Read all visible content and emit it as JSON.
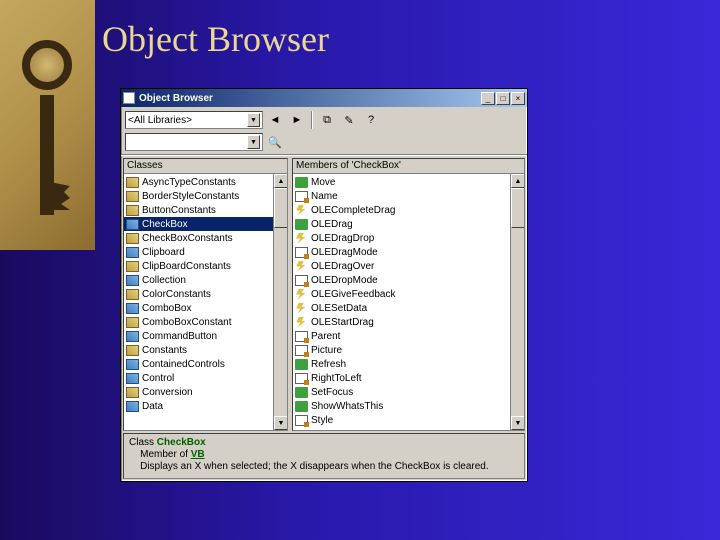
{
  "slide": {
    "title": "Object Browser"
  },
  "window": {
    "title": "Object Browser",
    "library_combo": "<All Libraries>",
    "search_combo": "",
    "nav_back_glyph": "◄",
    "nav_fwd_glyph": "►",
    "copy_glyph": "⧉",
    "def_glyph": "✎",
    "help_glyph": "?",
    "min_glyph": "_",
    "max_glyph": "□",
    "close_glyph": "×",
    "dd_glyph": "▼",
    "up_glyph": "▲",
    "search_glyph": "🔍"
  },
  "classes": {
    "header": "Classes",
    "items": [
      {
        "icon": "enum",
        "label": "AsyncTypeConstants"
      },
      {
        "icon": "enum",
        "label": "BorderStyleConstants"
      },
      {
        "icon": "enum",
        "label": "ButtonConstants"
      },
      {
        "icon": "class",
        "label": "CheckBox",
        "selected": true
      },
      {
        "icon": "enum",
        "label": "CheckBoxConstants"
      },
      {
        "icon": "class",
        "label": "Clipboard"
      },
      {
        "icon": "enum",
        "label": "ClipBoardConstants"
      },
      {
        "icon": "class",
        "label": "Collection"
      },
      {
        "icon": "enum",
        "label": "ColorConstants"
      },
      {
        "icon": "class",
        "label": "ComboBox"
      },
      {
        "icon": "enum",
        "label": "ComboBoxConstant"
      },
      {
        "icon": "class",
        "label": "CommandButton"
      },
      {
        "icon": "enum",
        "label": "Constants"
      },
      {
        "icon": "class",
        "label": "ContainedControls"
      },
      {
        "icon": "class",
        "label": "Control"
      },
      {
        "icon": "enum",
        "label": "Conversion"
      },
      {
        "icon": "class",
        "label": "Data"
      }
    ]
  },
  "members": {
    "header": "Members of 'CheckBox'",
    "items": [
      {
        "icon": "method",
        "label": "Move"
      },
      {
        "icon": "prop",
        "label": "Name"
      },
      {
        "icon": "event",
        "label": "OLECompleteDrag"
      },
      {
        "icon": "method",
        "label": "OLEDrag"
      },
      {
        "icon": "event",
        "label": "OLEDragDrop"
      },
      {
        "icon": "prop",
        "label": "OLEDragMode"
      },
      {
        "icon": "event",
        "label": "OLEDragOver"
      },
      {
        "icon": "prop",
        "label": "OLEDropMode"
      },
      {
        "icon": "event",
        "label": "OLEGiveFeedback"
      },
      {
        "icon": "event",
        "label": "OLESetData"
      },
      {
        "icon": "event",
        "label": "OLEStartDrag"
      },
      {
        "icon": "prop",
        "label": "Parent"
      },
      {
        "icon": "prop",
        "label": "Picture"
      },
      {
        "icon": "method",
        "label": "Refresh"
      },
      {
        "icon": "prop",
        "label": "RightToLeft"
      },
      {
        "icon": "method",
        "label": "SetFocus"
      },
      {
        "icon": "method",
        "label": "ShowWhatsThis"
      },
      {
        "icon": "prop",
        "label": "Style"
      }
    ]
  },
  "detail": {
    "line1_a": "Class ",
    "line1_b": "CheckBox",
    "line2_a": "    Member of ",
    "line2_b": "VB",
    "line3": "    Displays an X when selected; the X disappears when the CheckBox is cleared."
  }
}
